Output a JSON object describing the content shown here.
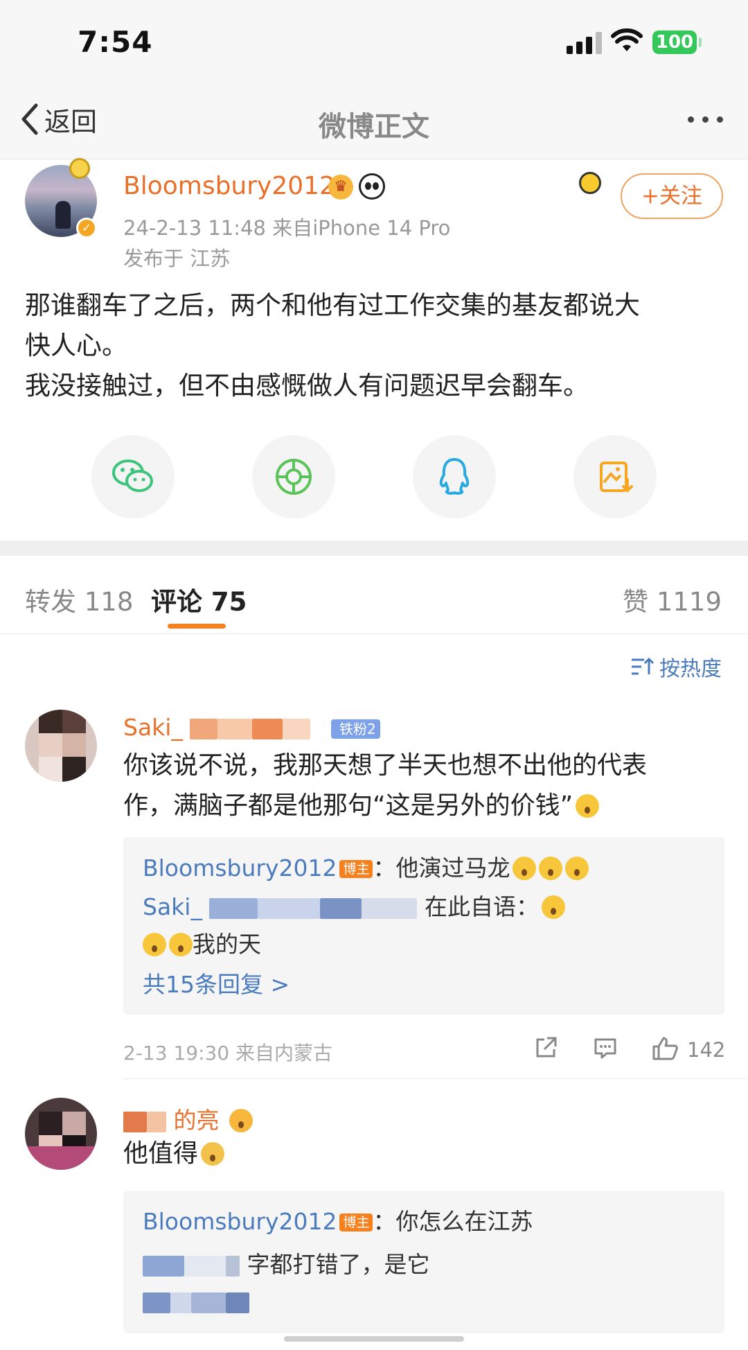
{
  "status_bar": {
    "time": "7:54",
    "battery": "100"
  },
  "nav": {
    "back_label": "返回",
    "title": "微博正文"
  },
  "post": {
    "username": "Bloomsbury2012",
    "meta": "24-2-13 11:48  来自iPhone 14 Pro",
    "location": "发布于 江苏",
    "follow_label": "+关注",
    "body_lines": [
      "那谁翻车了之后，两个和他有过工作交集的基友都说大",
      "快人心。",
      "我没接触过，但不由感慨做人有问题迟早会翻车。"
    ]
  },
  "share": [
    {
      "icon": "wechat-icon",
      "color": "#3cc47c"
    },
    {
      "icon": "moments-icon",
      "color": "#5cc35b"
    },
    {
      "icon": "qq-icon",
      "color": "#27a9e1"
    },
    {
      "icon": "save-image-icon",
      "color": "#f5a623"
    }
  ],
  "tabs": {
    "repost": "转发 118",
    "comments": "评论 75",
    "likes": "赞 1119"
  },
  "sort_label": "按热度",
  "comments": [
    {
      "name_visible": "Saki_",
      "fan_badge": "铁粉2",
      "text_lines": [
        "你该说不说，我那天想了半天也想不出他的代表",
        "作，满脑子都是他那句“这是另外的价钱”"
      ],
      "replies": [
        {
          "name": "Bloomsbury2012",
          "tag": "博主",
          "text": "：他演过马龙"
        },
        {
          "name": "Saki_",
          "text": "在此自语："
        },
        {
          "text": "我的天"
        }
      ],
      "total_replies": "共15条回复 >",
      "footer": "2-13 19:30 来自内蒙古",
      "likes": "142"
    },
    {
      "name_visible": "的亮",
      "text": "他值得",
      "replies": [
        {
          "name": "Bloomsbury2012",
          "tag": "博主",
          "text": "：你怎么在江苏"
        },
        {
          "text": "字都打错了，是它"
        }
      ]
    }
  ]
}
